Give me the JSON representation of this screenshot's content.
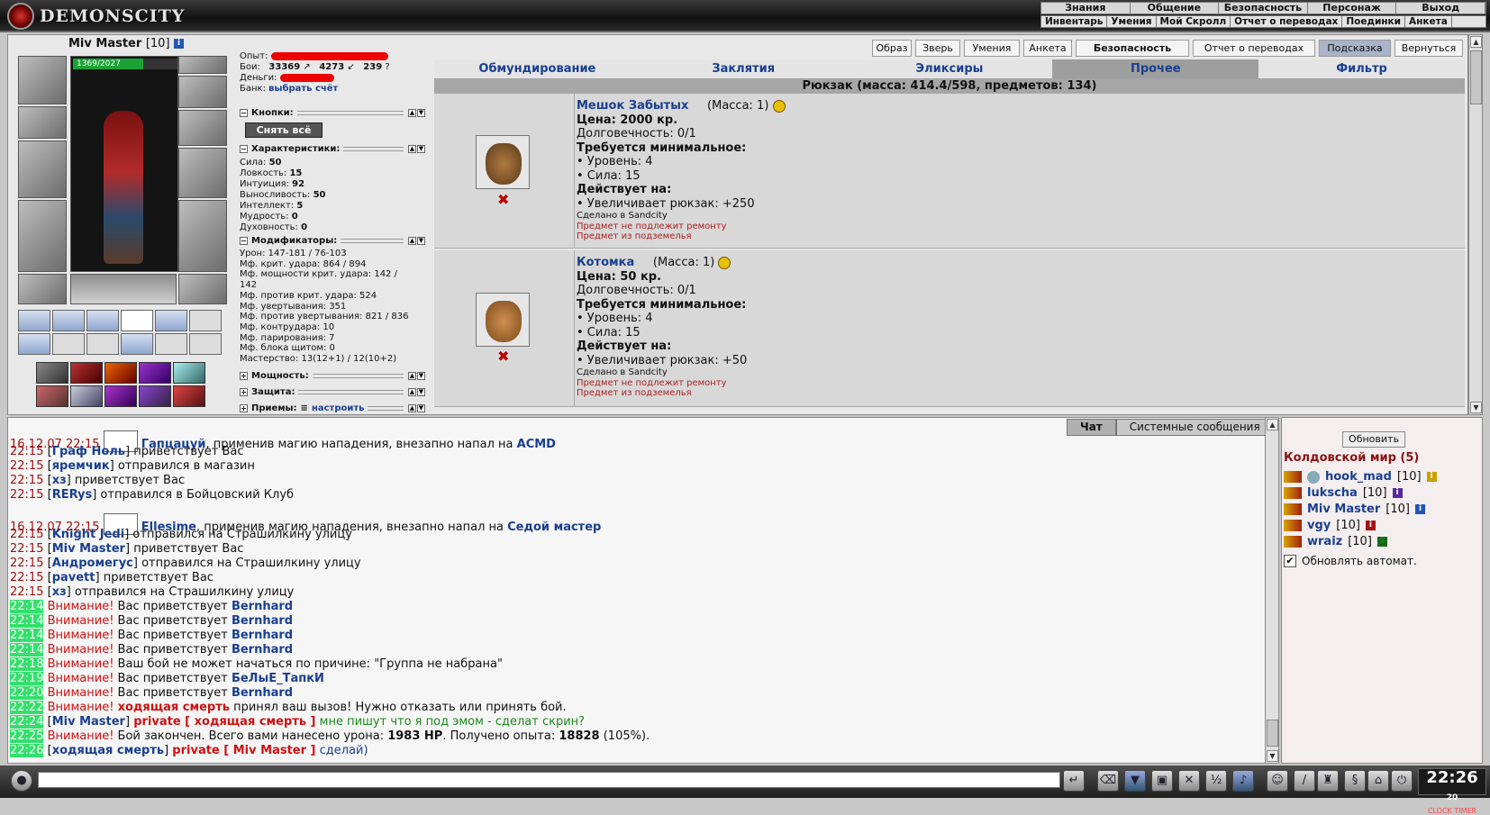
{
  "app": {
    "title": "DEMONSCITY"
  },
  "main_menu": [
    "Знания",
    "Общение",
    "Безопасность",
    "Персонаж",
    "Выход"
  ],
  "sub_menu": [
    "Инвентарь",
    "Умения",
    "Мой Скролл",
    "Отчет о переводах",
    "Поединки",
    "Анкета"
  ],
  "character": {
    "name": "Miv Master",
    "level": "[10]",
    "hp": "1369/2027",
    "hp_fraction": 0.675,
    "exp_label": "Опыт:",
    "fights_label": "Бои:",
    "fights_wins": "33369",
    "fights_losses": "4273",
    "fights_draws": "239",
    "money_label": "Деньги:",
    "bank_label": "Банк:",
    "bank_link": "выбрать счёт"
  },
  "sections": {
    "buttons": "Кнопки:",
    "remove_all": "Снять всё",
    "characteristics": "Характеристики:",
    "modifiers": "Модификаторы:",
    "power": "Мощность:",
    "protection": "Защита:",
    "techniques": "Приемы:",
    "techniques_link": "настроить"
  },
  "characteristics": [
    {
      "label": "Сила:",
      "value": "50"
    },
    {
      "label": "Ловкость:",
      "value": "15"
    },
    {
      "label": "Интуиция:",
      "value": "92"
    },
    {
      "label": "Выносливость:",
      "value": "50"
    },
    {
      "label": "Интеллект:",
      "value": "5"
    },
    {
      "label": "Мудрость:",
      "value": "0"
    },
    {
      "label": "Духовность:",
      "value": "0"
    }
  ],
  "modifiers": [
    "Урон: 147-181 / 76-103",
    "Мф. крит. удара: 864 / 894",
    "Мф. мощности крит. удара: 142 /",
    "142",
    "Мф. против крит. удара: 524",
    "Мф. увертывания: 351",
    "Мф. против увертывания: 821 / 836",
    "Мф. контрудара: 10",
    "Мф. парирования: 7",
    "Мф. блока щитом: 0",
    "Мастерство: 13(12+1) / 12(10+2)"
  ],
  "header_buttons": [
    "Образ",
    "Зверь",
    "Умения",
    "Анкета",
    "Безопасность",
    "Отчет о переводах",
    "Подсказка",
    "Вернуться"
  ],
  "tabs": [
    "Обмундирование",
    "Заклятия",
    "Эликсиры",
    "Прочее",
    "Фильтр"
  ],
  "active_tab": "Прочее",
  "backpack_title": "Рюкзак (масса: 414.4/598, предметов: 134)",
  "items": [
    {
      "name": "Мешок Забытых",
      "mass": "(Масса: 1)",
      "price": "Цена: 2000 кр.",
      "durability": "Долговечность: 0/1",
      "req_title": "Требуется минимальное:",
      "req": [
        "• Уровень: 4",
        "• Сила: 15"
      ],
      "effect_title": "Действует на:",
      "effect": "• Увеличивает рюкзак: +250",
      "made": "Сделано в Sandcity",
      "warn1": "Предмет не подлежит ремонту",
      "warn2": "Предмет из подземелья"
    },
    {
      "name": "Котомка",
      "mass": "(Масса: 1)",
      "price": "Цена: 50 кр.",
      "durability": "Долговечность: 0/1",
      "req_title": "Требуется минимальное:",
      "req": [
        "• Уровень: 4",
        "• Сила: 15"
      ],
      "effect_title": "Действует на:",
      "effect": "• Увеличивает рюкзак: +50",
      "made": "Сделано в Sandcity",
      "warn1": "Предмет не подлежит ремонту",
      "warn2": "Предмет из подземелья"
    }
  ],
  "chat_tabs": [
    "Чат",
    "Системные сообщения"
  ],
  "chat": {
    "l1_time": "16.12.07 22:15",
    "l1_nick": "Гапцацуй",
    "l1_text": ", применив магию нападения, внезапно напал на ",
    "l1_target": "ACMD",
    "l2_time": "22:15",
    "l2_nick": "Граф Ноль",
    "l2_text": " приветствует Вас",
    "l3_time": "22:15",
    "l3_nick": "яремчик",
    "l3_text": " отправился в магазин",
    "l4_time": "22:15",
    "l4_nick": "хз",
    "l4_text": " приветствует Вас",
    "l5_time": "22:15",
    "l5_nick": "RERys",
    "l5_text": " отправился в Бойцовский Клуб",
    "l6_time": "16.12.07 22:15",
    "l6_nick": "Ellesime",
    "l6_text": ", применив магию нападения, внезапно напал на ",
    "l6_target": "Седой мастер",
    "l7_time": "22:15",
    "l7_nick": "Knight Jedi",
    "l7_text": " отправился на Страшилкину улицу",
    "l8_time": "22:15",
    "l8_nick": "Miv Master",
    "l8_text": " приветствует Вас",
    "l9_time": "22:15",
    "l9_nick": "Андромегус",
    "l9_text": " отправился на Страшилкину улицу",
    "l10_time": "22:15",
    "l10_nick": "pavett",
    "l10_text": " приветствует Вас",
    "l11_time": "22:15",
    "l11_nick": "хз",
    "l11_text": " отправился на Страшилкину улицу",
    "warn": "Внимание!",
    "greets": " Вас приветствует ",
    "l12_time": "22:14",
    "l12_nick": "Bernhard",
    "l13_time": "22:14",
    "l13_nick": "Bernhard",
    "l14_time": "22:14",
    "l14_nick": "Bernhard",
    "l15_time": "22:14",
    "l15_nick": "Bernhard",
    "l16_time": "22:18",
    "l16_text": " Ваш бой не может начаться по причине: \"Группа не набрана\"",
    "l17_time": "22:19",
    "l17_nick": "БеЛыЕ_ТапкИ",
    "l18_time": "22:20",
    "l18_nick": "Bernhard",
    "l19_time": "22:22",
    "l19_nick": "ходящая смерть",
    "l19_text": " принял ваш вызов! Нужно отказать или принять бой.",
    "l20_time": "22:24",
    "l20_nick": "Miv Master",
    "l20_private": "private [ ходящая смерть ]",
    "l20_text": " мне пишут что я под эмом - сделат скрин?",
    "l21_time": "22:25",
    "l21_text_a": " Бой закончен. Всего вами нанесено урона: ",
    "l21_dmg": "1983 HP",
    "l21_text_b": ". Получено опыта: ",
    "l21_exp": "18828",
    "l21_text_c": " (105%).",
    "l22_time": "22:26",
    "l22_nick": "ходящая смерть",
    "l22_private": "private [ Miv Master ]",
    "l22_text": " сделай)"
  },
  "who": {
    "refresh": "Обновить",
    "location": "Колдовской мир (5)",
    "players": [
      {
        "name": "hook_mad",
        "level": "[10]"
      },
      {
        "name": "lukscha",
        "level": "[10]"
      },
      {
        "name": "Miv Master",
        "level": "[10]"
      },
      {
        "name": "vgy",
        "level": "[10]"
      },
      {
        "name": "wraiz",
        "level": "[10]"
      }
    ],
    "auto_update": "Обновлять автомат."
  },
  "clock": {
    "time": "22:26",
    "seconds": "20",
    "label": "CLOCK TIMER"
  }
}
